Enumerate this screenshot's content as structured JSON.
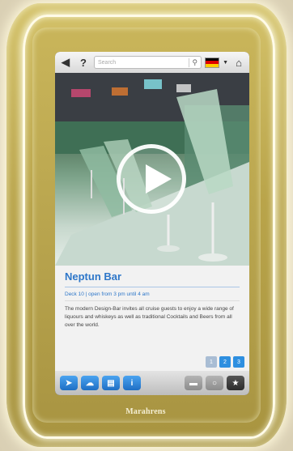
{
  "search": {
    "placeholder": "Search"
  },
  "header": {
    "help_label": "?",
    "back_icon": "back-arrow-icon",
    "home_icon": "home-icon",
    "language_flag_colors": [
      "#000000",
      "#dd0000",
      "#ffce00"
    ]
  },
  "article": {
    "title": "Neptun Bar",
    "subtitle": "Deck 10 | open from 3 pm until 4 am",
    "description": "The modern Design-Bar invites all cruise guests to enjoy a wide range of liquours and whiskeys as well as traditional Cocktails and Beers from all over the world."
  },
  "pagination": {
    "pages": [
      "1",
      "2",
      "3"
    ],
    "current": "2"
  },
  "toolbar": {
    "icons": [
      "navigate-icon",
      "weather-icon",
      "document-icon",
      "info-icon",
      "ship-icon",
      "clock-icon",
      "favorite-star-icon"
    ]
  },
  "brand": {
    "name": "Marahrens"
  },
  "colors": {
    "accent": "#2e77c9",
    "frame": "#c9b55a"
  }
}
